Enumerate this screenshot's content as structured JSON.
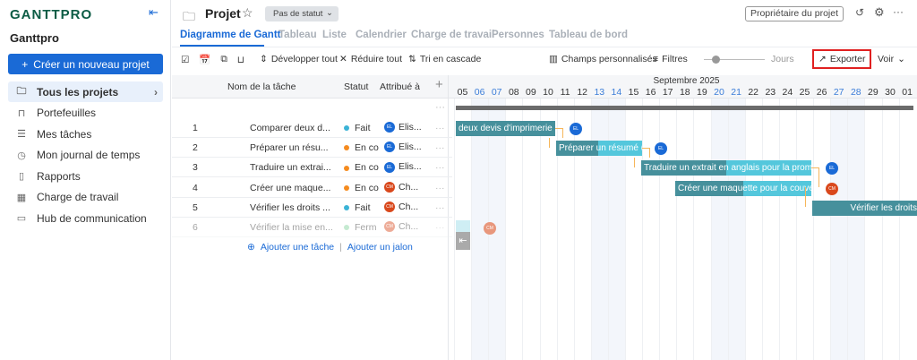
{
  "sidebar": {
    "logo": "GANTTPRO",
    "workspace": "Ganttpro",
    "create_label": "Créer un nouveau projet",
    "items": [
      {
        "label": "Tous les projets",
        "icon": "folder-icon"
      },
      {
        "label": "Portefeuilles",
        "icon": "briefcase-icon"
      },
      {
        "label": "Mes tâches",
        "icon": "list-icon"
      },
      {
        "label": "Mon journal de temps",
        "icon": "clock-icon"
      },
      {
        "label": "Rapports",
        "icon": "report-icon"
      },
      {
        "label": "Charge de travail",
        "icon": "grid-icon"
      },
      {
        "label": "Hub de communication",
        "icon": "chat-icon"
      }
    ]
  },
  "header": {
    "title": "Projet",
    "status": "Pas de statut",
    "owner": "Propriétaire du projet"
  },
  "tabs": [
    "Diagramme de Gantt",
    "Tableau",
    "Liste",
    "Calendrier",
    "Charge de travail",
    "Personnes",
    "Tableau de bord"
  ],
  "toolbar": {
    "expand": "Développer tout",
    "collapse": "Réduire tout",
    "sort": "Tri en cascade",
    "custom_fields": "Champs personnalisés",
    "filters": "Filtres",
    "zoom_label": "Jours",
    "export": "Exporter",
    "view": "Voir"
  },
  "table": {
    "headers": {
      "name": "Nom de la tâche",
      "status": "Statut",
      "assigned": "Attribué à"
    },
    "rows": [
      {
        "num": "1",
        "name": "Comparer deux d...",
        "status": "Fait",
        "status_color": "#3bb3d6",
        "assignee": "Elis...",
        "initials": "EL",
        "av_color": "#1a6ad6"
      },
      {
        "num": "2",
        "name": "Préparer un résu...",
        "status": "En co",
        "status_color": "#f58b1f",
        "assignee": "Elis...",
        "initials": "EL",
        "av_color": "#1a6ad6"
      },
      {
        "num": "3",
        "name": "Traduire un extrai...",
        "status": "En co",
        "status_color": "#f58b1f",
        "assignee": "Elis...",
        "initials": "EL",
        "av_color": "#1a6ad6"
      },
      {
        "num": "4",
        "name": "Créer une maque...",
        "status": "En co",
        "status_color": "#f58b1f",
        "assignee": "Ch...",
        "initials": "CM",
        "av_color": "#d9481c"
      },
      {
        "num": "5",
        "name": "Vérifier les droits ...",
        "status": "Fait",
        "status_color": "#3bb3d6",
        "assignee": "Ch...",
        "initials": "CM",
        "av_color": "#d9481c"
      },
      {
        "num": "6",
        "name": "Vérifier la mise en...",
        "status": "Ferm",
        "status_color": "#7fd19a",
        "assignee": "Ch...",
        "initials": "CM",
        "av_color": "#d9481c"
      }
    ],
    "add_task": "Ajouter une tâche",
    "add_milestone": "Ajouter un jalon"
  },
  "gantt": {
    "month": "Septembre 2025",
    "days": [
      "05",
      "06",
      "07",
      "08",
      "09",
      "10",
      "11",
      "12",
      "13",
      "14",
      "15",
      "16",
      "17",
      "18",
      "19",
      "20",
      "21",
      "22",
      "23",
      "24",
      "25",
      "26",
      "27",
      "28",
      "29",
      "30",
      "01"
    ],
    "weekends": [
      "06",
      "07",
      "13",
      "14",
      "20",
      "21",
      "27",
      "28"
    ],
    "bars": [
      {
        "label": "deux devis d'imprimerie p...",
        "initials": "EL",
        "av_color": "#1a6ad6"
      },
      {
        "label": "Préparer un résumé (...",
        "initials": "EL",
        "av_color": "#1a6ad6"
      },
      {
        "label": "Traduire un extrait en anglais pour la promotion",
        "initials": "EL",
        "av_color": "#1a6ad6"
      },
      {
        "label": "Créer une maquette pour la couverture",
        "initials": "CM",
        "av_color": "#d9481c"
      },
      {
        "label": "Vérifier les droits",
        "initials": "",
        "av_color": ""
      },
      {
        "label": "",
        "initials": "CM",
        "av_color": "#e8977c"
      }
    ]
  }
}
